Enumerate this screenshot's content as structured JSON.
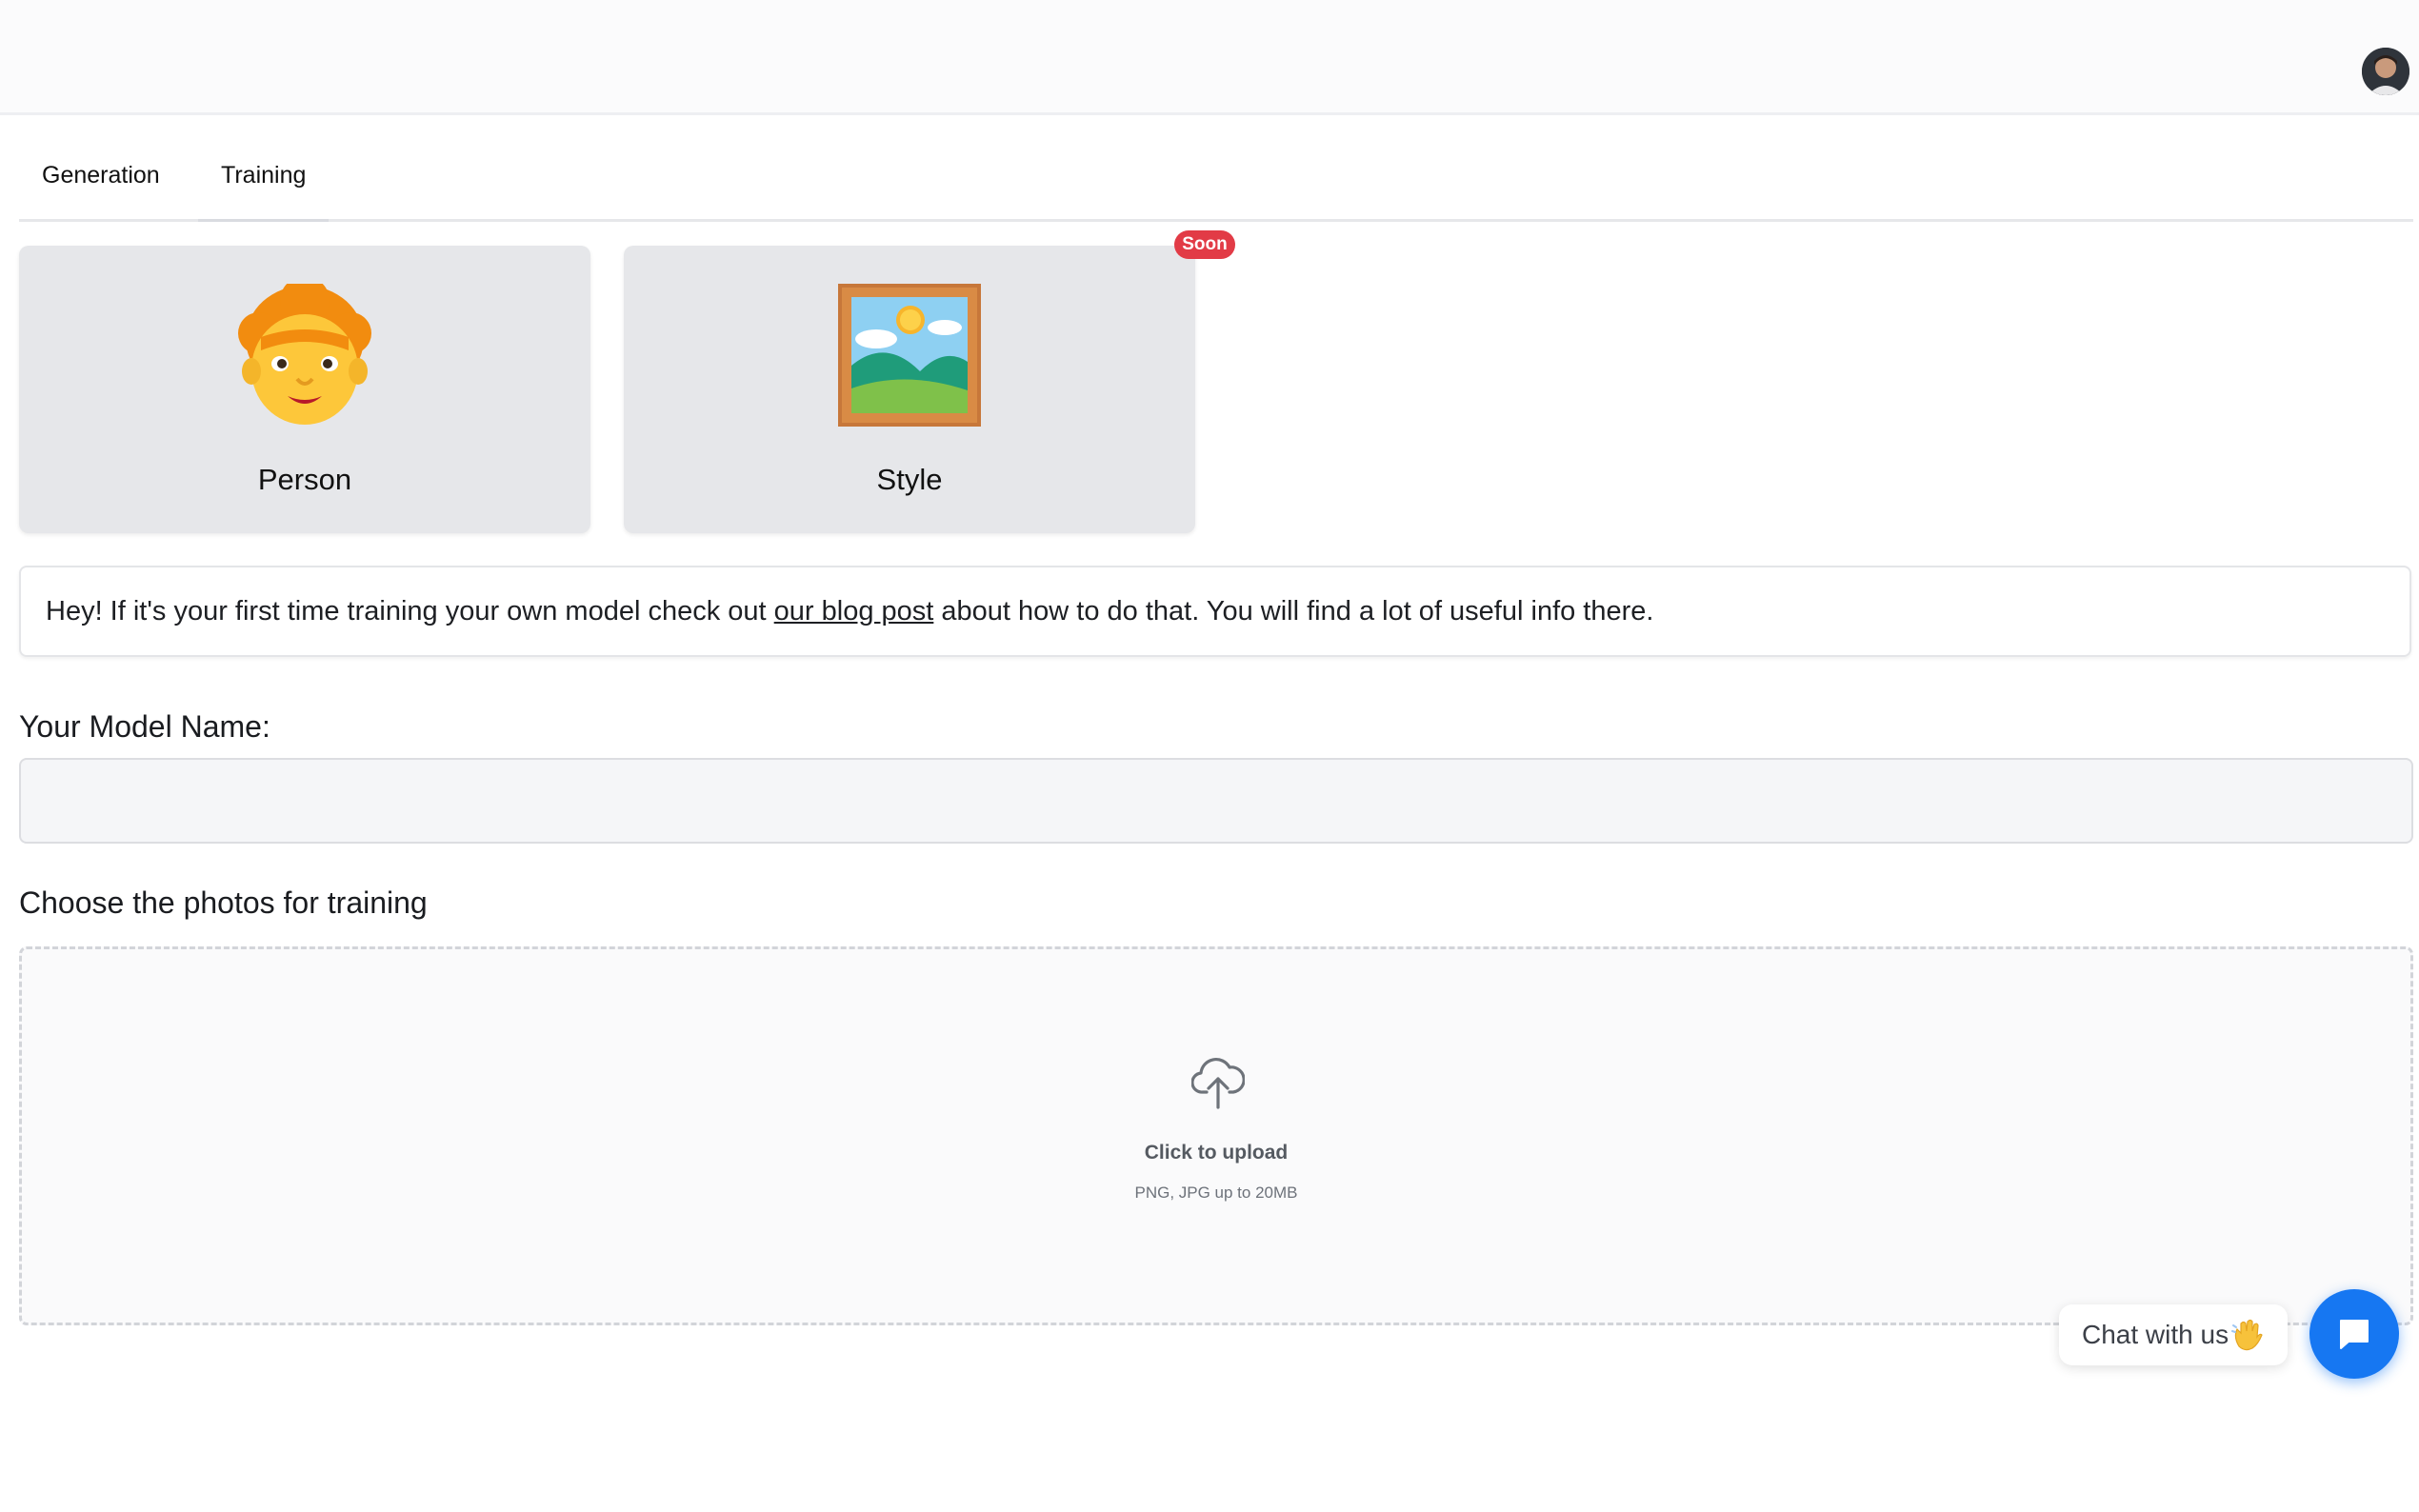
{
  "header": {
    "avatar_icon": "user-avatar"
  },
  "tabs": [
    {
      "label": "Generation",
      "active": false
    },
    {
      "label": "Training",
      "active": true
    }
  ],
  "model_types": [
    {
      "label": "Person",
      "icon": "person-emoji-icon"
    },
    {
      "label": "Style",
      "icon": "framed-picture-icon",
      "badge": "Soon"
    }
  ],
  "info": {
    "before_link": "Hey! If it's your first time training your own model check out ",
    "link_text": "our blog post",
    "after_link": " about how to do that. You will find a lot of useful info there."
  },
  "model_name": {
    "label": "Your Model Name:",
    "value": "",
    "placeholder": ""
  },
  "upload": {
    "label": "Choose the photos for training",
    "icon": "cloud-upload-icon",
    "title": "Click to upload",
    "subtitle": "PNG, JPG up to 20MB"
  },
  "chat": {
    "label": "Chat with us",
    "wave_icon": "waving-hand-icon",
    "button_icon": "chat-bubble-icon"
  },
  "colors": {
    "badge": "#e23b46",
    "chat_button": "#1677f2",
    "card_bg": "#e6e7ea"
  }
}
